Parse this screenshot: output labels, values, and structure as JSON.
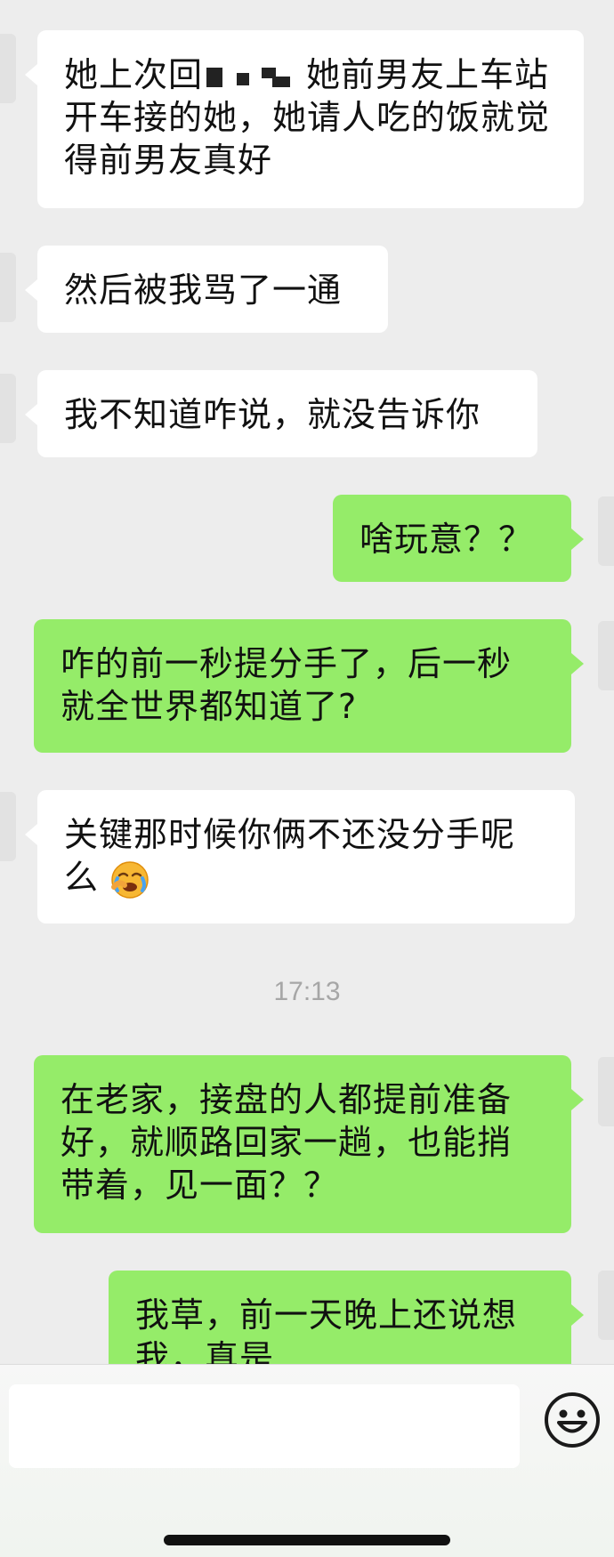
{
  "messages": [
    {
      "side": "in",
      "text_before": "她上次回",
      "text_after": "她前男友上车站开车接的她，她请人吃的饭就觉得前男友真好",
      "redacted": true
    },
    {
      "side": "in",
      "text": "然后被我骂了一通"
    },
    {
      "side": "in",
      "text": "我不知道咋说，就没告诉你"
    },
    {
      "side": "out",
      "text": "啥玩意？？"
    },
    {
      "side": "out",
      "text": "咋的前一秒提分手了，后一秒就全世界都知道了?"
    },
    {
      "side": "in",
      "text": "关键那时候你俩不还没分手呢么",
      "emoji": "face-with-tears"
    },
    {
      "side": "out",
      "text": "在老家，接盘的人都提前准备好，就顺路回家一趟，也能捎带着，见一面？？"
    },
    {
      "side": "out",
      "text": "我草，前一天晚上还说想我，真是"
    }
  ],
  "timestamp": "17:13",
  "input": {
    "value": ""
  },
  "icons": {
    "emoji_button": "smiley-face-icon"
  },
  "colors": {
    "background": "#ededed",
    "incoming": "#ffffff",
    "outgoing": "#95ec69"
  }
}
